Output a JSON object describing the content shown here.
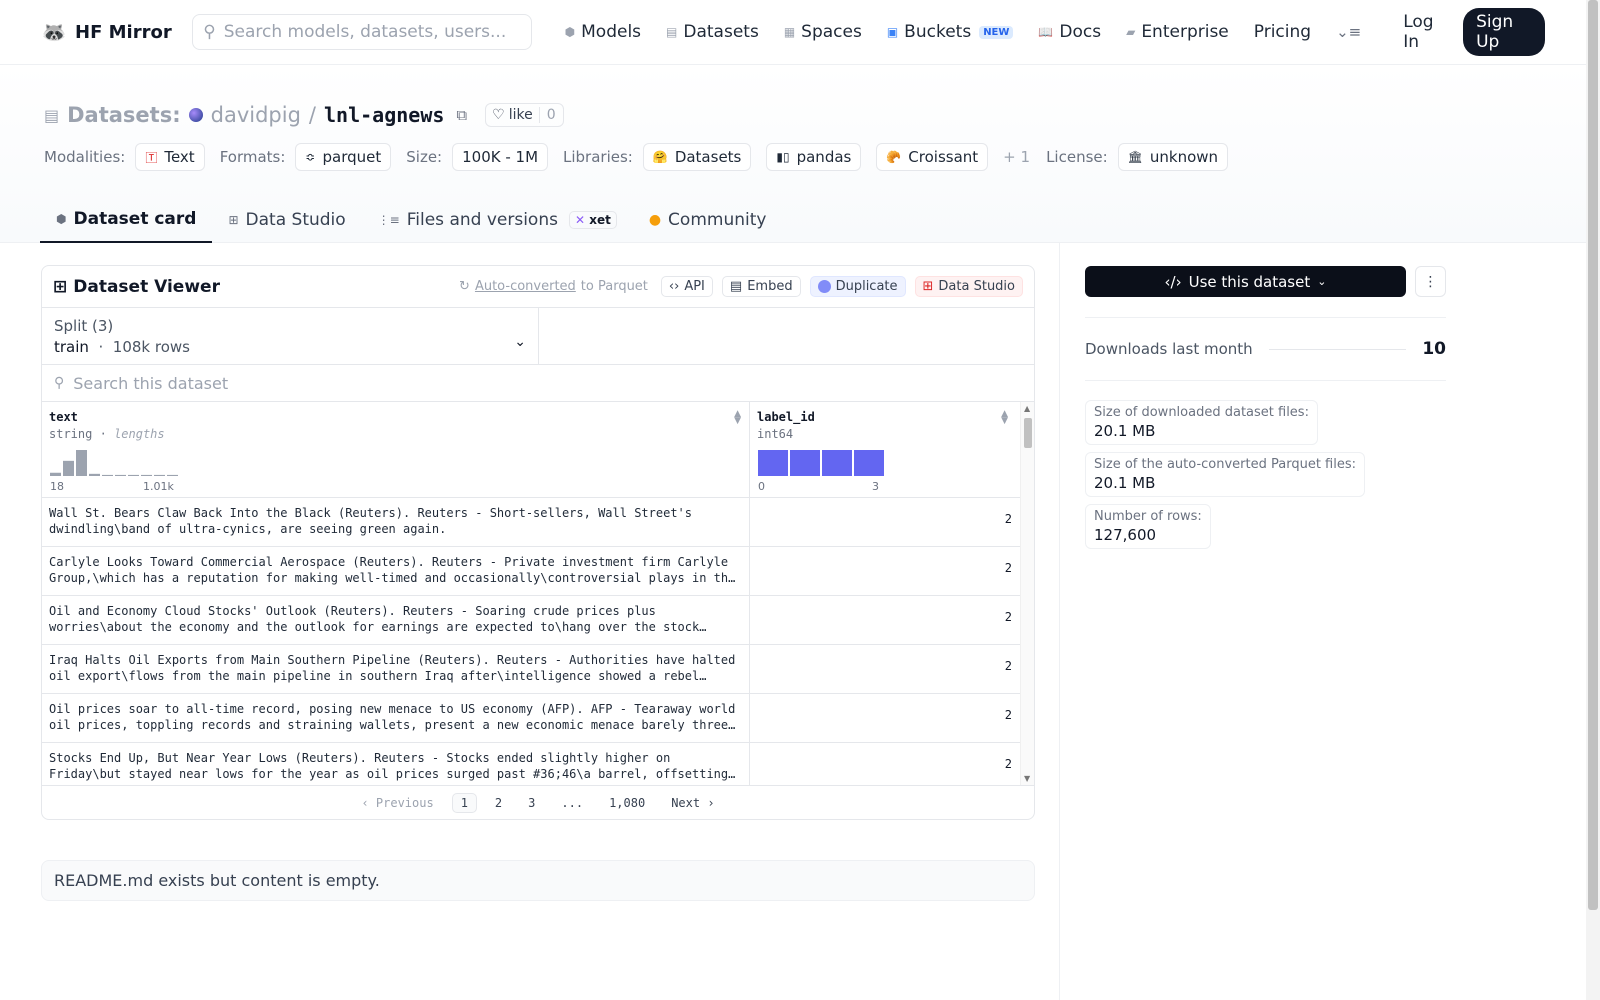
{
  "nav": {
    "brand": "HF Mirror",
    "search_placeholder": "Search models, datasets, users...",
    "links": {
      "models": "Models",
      "datasets": "Datasets",
      "spaces": "Spaces",
      "buckets": "Buckets",
      "buckets_badge": "NEW",
      "docs": "Docs",
      "enterprise": "Enterprise",
      "pricing": "Pricing"
    },
    "login": "Log In",
    "signup": "Sign Up"
  },
  "header": {
    "label": "Datasets:",
    "owner": "davidpig",
    "separator": "/",
    "repo": "lnl-agnews",
    "like_label": "like",
    "like_count": "0",
    "tags": {
      "modalities_label": "Modalities:",
      "modality": "Text",
      "formats_label": "Formats:",
      "format": "parquet",
      "size_label": "Size:",
      "size": "100K - 1M",
      "libraries_label": "Libraries:",
      "lib1": "Datasets",
      "lib2": "pandas",
      "lib3": "Croissant",
      "more": "+ 1",
      "license_label": "License:",
      "license": "unknown"
    },
    "tabs": {
      "card": "Dataset card",
      "studio": "Data Studio",
      "files": "Files and versions",
      "files_badge": "xet",
      "community": "Community"
    }
  },
  "viewer": {
    "title": "Dataset Viewer",
    "autoconv_link": "Auto-converted",
    "autoconv_rest": "to Parquet",
    "api": "API",
    "embed": "Embed",
    "duplicate": "Duplicate",
    "data_studio": "Data Studio",
    "split_label": "Split (3)",
    "split_name": "train",
    "split_dot": "·",
    "split_rows": "108k rows",
    "search_placeholder": "Search this dataset",
    "columns": {
      "c1_name": "text",
      "c1_type": "string",
      "c1_dot": "·",
      "c1_sub": "lengths",
      "c1_min": "18",
      "c1_max": "1.01k",
      "c2_name": "label_id",
      "c2_type": "int64",
      "c2_min": "0",
      "c2_max": "3"
    },
    "rows": [
      {
        "text": "Wall St. Bears Claw Back Into the Black (Reuters). Reuters - Short-sellers, Wall Street's dwindling\\band of ultra-cynics, are seeing green again.",
        "label": "2"
      },
      {
        "text": "Carlyle Looks Toward Commercial Aerospace (Reuters). Reuters - Private investment firm Carlyle Group,\\which has a reputation for making well-timed and occasionally\\controversial plays in the defense industry, has quietly placed its bets on another part of the market.",
        "label": "2"
      },
      {
        "text": "Oil and Economy Cloud Stocks' Outlook (Reuters). Reuters - Soaring crude prices plus worries\\about the economy and the outlook for earnings are expected to\\hang over the stock market next week during the depth of the summer doldrums.",
        "label": "2"
      },
      {
        "text": "Iraq Halts Oil Exports from Main Southern Pipeline (Reuters). Reuters - Authorities have halted oil export\\flows from the main pipeline in southern Iraq after\\intelligence showed a rebel militia could strike infrastructure, an oil official said on Saturday.",
        "label": "2"
      },
      {
        "text": "Oil prices soar to all-time record, posing new menace to US economy (AFP). AFP - Tearaway world oil prices, toppling records and straining wallets, present a new economic menace barely three months before the US presidential elections.",
        "label": "2"
      },
      {
        "text": "Stocks End Up, But Near Year Lows (Reuters). Reuters - Stocks ended slightly higher on Friday\\but stayed near lows for the year as oil prices surged past #36;46\\a barrel, offsetting a positive outlook from computer maker Dell Inc.",
        "label": "2"
      }
    ],
    "pager": {
      "prev": "Previous",
      "p1": "1",
      "p2": "2",
      "p3": "3",
      "ellipsis": "...",
      "last": "1,080",
      "next": "Next"
    }
  },
  "readme": "README.md exists but content is empty.",
  "sidebar": {
    "use_button": "Use this dataset",
    "downloads_label": "Downloads last month",
    "downloads_value": "10",
    "stats": [
      {
        "label": "Size of downloaded dataset files:",
        "value": "20.1 MB"
      },
      {
        "label": "Size of the auto-converted Parquet files:",
        "value": "20.1 MB"
      },
      {
        "label": "Number of rows:",
        "value": "127,600"
      }
    ]
  },
  "charts": {
    "text_lengths_histogram": [
      3,
      14,
      24,
      2,
      1,
      1,
      1,
      1,
      1,
      1
    ],
    "label_id_histogram": [
      25,
      25,
      25,
      25
    ]
  },
  "colors": {
    "accent": "#111827",
    "hist_gray": "#9ca3af",
    "hist_blue": "#6366f1"
  }
}
